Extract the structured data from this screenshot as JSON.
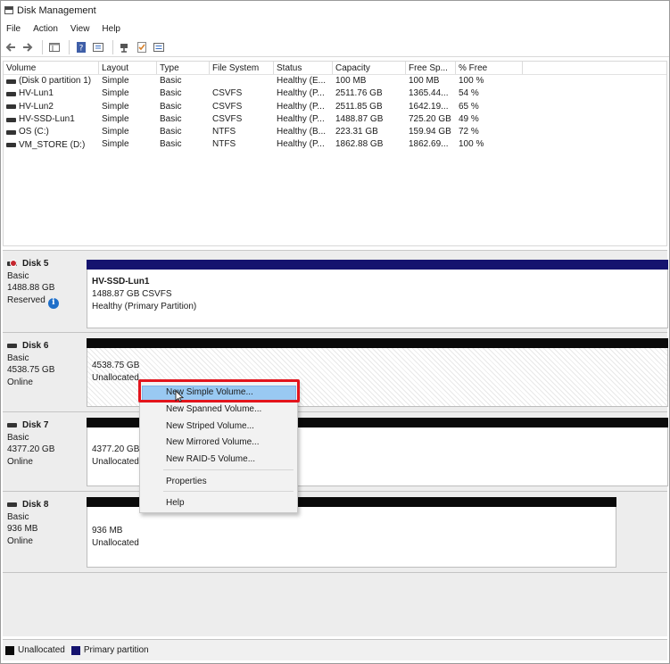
{
  "window": {
    "title": "Disk Management"
  },
  "menubar": [
    "File",
    "Action",
    "View",
    "Help"
  ],
  "toolbar": {
    "icons": [
      "back-arrow-icon",
      "forward-arrow-icon",
      "console-tree-icon",
      "help-icon",
      "properties-icon",
      "connect-icon",
      "check-icon",
      "list-view-icon"
    ]
  },
  "volume_table": {
    "columns": [
      "Volume",
      "Layout",
      "Type",
      "File System",
      "Status",
      "Capacity",
      "Free Sp...",
      "% Free"
    ],
    "rows": [
      [
        "(Disk 0 partition 1)",
        "Simple",
        "Basic",
        "",
        "Healthy (E...",
        "100 MB",
        "100 MB",
        "100 %"
      ],
      [
        "HV-Lun1",
        "Simple",
        "Basic",
        "CSVFS",
        "Healthy (P...",
        "2511.76 GB",
        "1365.44...",
        "54 %"
      ],
      [
        "HV-Lun2",
        "Simple",
        "Basic",
        "CSVFS",
        "Healthy (P...",
        "2511.85 GB",
        "1642.19...",
        "65 %"
      ],
      [
        "HV-SSD-Lun1",
        "Simple",
        "Basic",
        "CSVFS",
        "Healthy (P...",
        "1488.87 GB",
        "725.20 GB",
        "49 %"
      ],
      [
        "OS (C:)",
        "Simple",
        "Basic",
        "NTFS",
        "Healthy (B...",
        "223.31 GB",
        "159.94 GB",
        "72 %"
      ],
      [
        "VM_STORE (D:)",
        "Simple",
        "Basic",
        "NTFS",
        "Healthy (P...",
        "1862.88 GB",
        "1862.69...",
        "100 %"
      ]
    ]
  },
  "disks": [
    {
      "name": "Disk 5",
      "type": "Basic",
      "size": "1488.88 GB",
      "state": "Reserved",
      "partition": {
        "name": "HV-SSD-Lun1",
        "detail": "1488.87 GB CSVFS",
        "status": "Healthy (Primary Partition)"
      }
    },
    {
      "name": "Disk 6",
      "type": "Basic",
      "size": "4538.75 GB",
      "state": "Online",
      "partition": {
        "size": "4538.75 GB",
        "status": "Unallocated"
      }
    },
    {
      "name": "Disk 7",
      "type": "Basic",
      "size": "4377.20 GB",
      "state": "Online",
      "partition": {
        "size": "4377.20 GB",
        "status": "Unallocated"
      }
    },
    {
      "name": "Disk 8",
      "type": "Basic",
      "size": "936 MB",
      "state": "Online",
      "partition": {
        "size": "936 MB",
        "status": "Unallocated"
      }
    }
  ],
  "context_menu": {
    "items": [
      "New Simple Volume...",
      "New Spanned Volume...",
      "New Striped Volume...",
      "New Mirrored Volume...",
      "New RAID-5 Volume...",
      "Properties",
      "Help"
    ],
    "highlighted": "New Simple Volume..."
  },
  "legend": {
    "items": [
      {
        "label": "Unallocated",
        "color": "#0a0a0a"
      },
      {
        "label": "Primary partition",
        "color": "#15136f"
      }
    ]
  },
  "colors": {
    "primary": "#15136f",
    "unallocated": "#0a0a0a",
    "highlight": "#99c9f2",
    "callout": "#e3141c"
  }
}
